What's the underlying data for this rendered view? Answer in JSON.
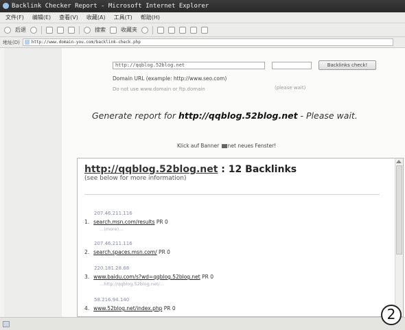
{
  "window": {
    "title": "Backlink Checker Report - Microsoft Internet Explorer"
  },
  "menu": {
    "items": [
      "文件(F)",
      "编辑(E)",
      "查看(V)",
      "收藏(A)",
      "工具(T)",
      "帮助(H)"
    ]
  },
  "toolbar": {
    "back_label": "后退",
    "search_label": "搜索",
    "favorites_label": "收藏夹"
  },
  "address": {
    "label": "地址(D)",
    "url": "http://www.domain-you.com/backlink-check.php"
  },
  "form": {
    "url_value": "http://qqblog.52blog.net",
    "submit_label": "Backlinks check!",
    "domain_label": "Domain URL (example: http://www.seo.com)",
    "note_left": "Do not use www.domain or ftp.domain",
    "note_right": "(please wait)"
  },
  "generate": {
    "prefix": "Generate report for ",
    "url": "http://qqblog.52blog.net",
    "suffix": " - Please wait."
  },
  "klick": {
    "before": "Klick auf Banner ",
    "after": "net neues Fenster!"
  },
  "results": {
    "url": "http://qqblog.52blog.net",
    "separator": " : ",
    "count_text": "12 Backlinks",
    "subtitle": "(see below for more information)",
    "entries": [
      {
        "ip": "207.46.211.116",
        "num": "1.",
        "link": "search.msn.com/results",
        "pr": "PR 0",
        "sub": "...(more)..."
      },
      {
        "ip": "207.46.211.116",
        "num": "2.",
        "link": "search.spaces.msn.com/",
        "pr": "PR 0",
        "sub": ""
      },
      {
        "ip": "220.181.28.68",
        "num": "3.",
        "link": "www.baidu.com/s?wd=qqblog.52blog.net",
        "pr": "PR 0",
        "sub": "...http://qqblog.52blog.net/..."
      },
      {
        "ip": "58.216.94.140",
        "num": "4.",
        "link": "www.52blog.net/index.php",
        "pr": "PR 0",
        "sub": ""
      }
    ]
  },
  "badge": {
    "text": "2"
  }
}
